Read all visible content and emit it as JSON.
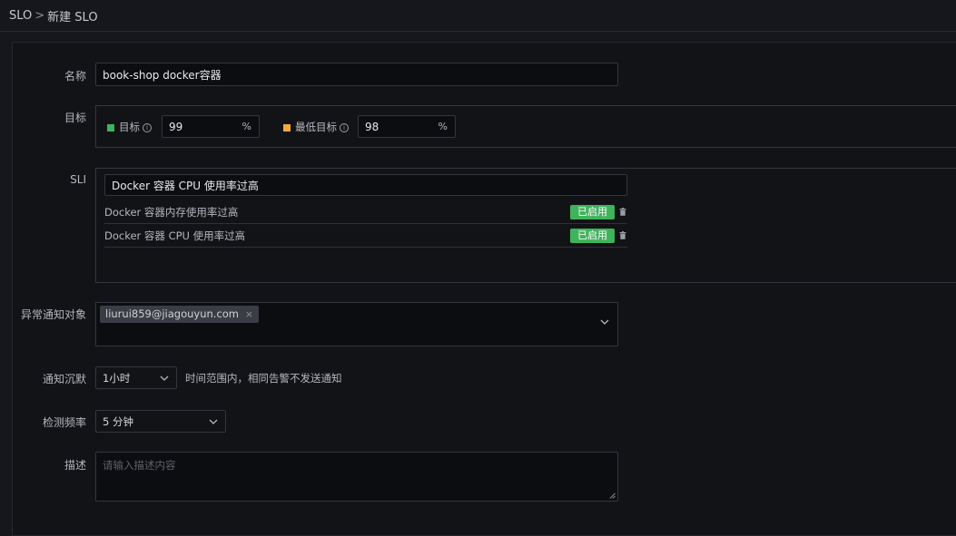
{
  "breadcrumb": {
    "root": "SLO",
    "separator": ">",
    "current": "新建 SLO"
  },
  "form": {
    "name_label": "名称",
    "name_value": "book-shop docker容器",
    "target_label": "目标",
    "target": {
      "goal_label": "目标",
      "goal_value": "99",
      "goal_unit": "%",
      "goal_color": "#3fb35b",
      "min_label": "最低目标",
      "min_value": "98",
      "min_unit": "%",
      "min_color": "#f2a93b",
      "info_glyph": "i"
    },
    "sli_label": "SLI",
    "sli": {
      "input_value": "Docker 容器 CPU 使用率过高",
      "items": [
        {
          "name": "Docker 容器内存使用率过高",
          "status": "已启用"
        },
        {
          "name": "Docker 容器 CPU 使用率过高",
          "status": "已启用"
        }
      ]
    },
    "notify_label": "异常通知对象",
    "notify_tag": "liurui859@jiagouyun.com",
    "notify_tag_close": "×",
    "silence_label": "通知沉默",
    "silence_value": "1小时",
    "silence_hint": "时间范围内，相同告警不发送通知",
    "freq_label": "检测频率",
    "freq_value": "5 分钟",
    "desc_label": "描述",
    "desc_placeholder": "请输入描述内容"
  },
  "colors": {
    "accent_green": "#3fb35b",
    "warning_orange": "#f2a93b"
  }
}
